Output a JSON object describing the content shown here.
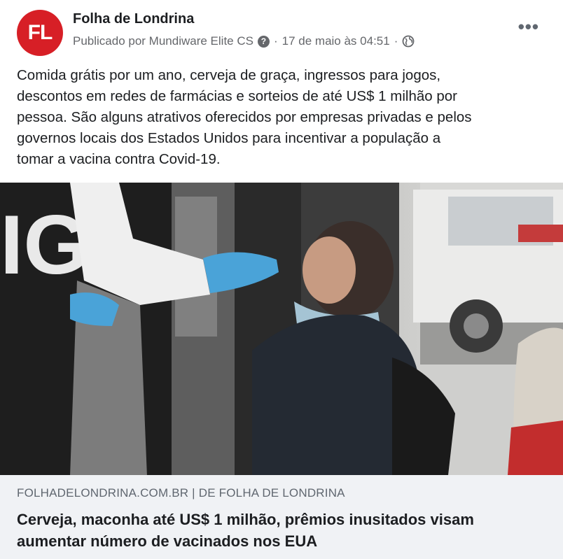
{
  "post": {
    "avatar_text": "FL",
    "page_name": "Folha de Londrina",
    "published_by": "Publicado por Mundiware Elite CS",
    "date": "17 de maio às 04:51",
    "separator": "·",
    "more_label": "•••",
    "caption": "Comida grátis por um ano, cerveja de graça, ingressos para jogos,\ndescontos em redes de farmácias e sorteios de até US$ 1 milhão por\npessoa. São alguns atrativos oferecidos por  empresas privadas e pelos\ngovernos locais dos Estados Unidos para incentivar a população a\ntomar a vacina contra Covid-19.",
    "photo_sign_text": "IG"
  },
  "link": {
    "domain": "FOLHADELONDRINA.COM.BR | DE FOLHA DE LONDRINA",
    "headline": "Cerveja, maconha até US$ 1 milhão, prêmios inusitados visam aumentar número de vacinados nos EUA"
  },
  "colors": {
    "brand": "#d71f26",
    "link_bg": "#f0f2f5",
    "meta_text": "#65676b"
  },
  "icons": {
    "privacy": "question-icon",
    "audience": "globe-icon",
    "menu": "more-horizontal-icon"
  }
}
